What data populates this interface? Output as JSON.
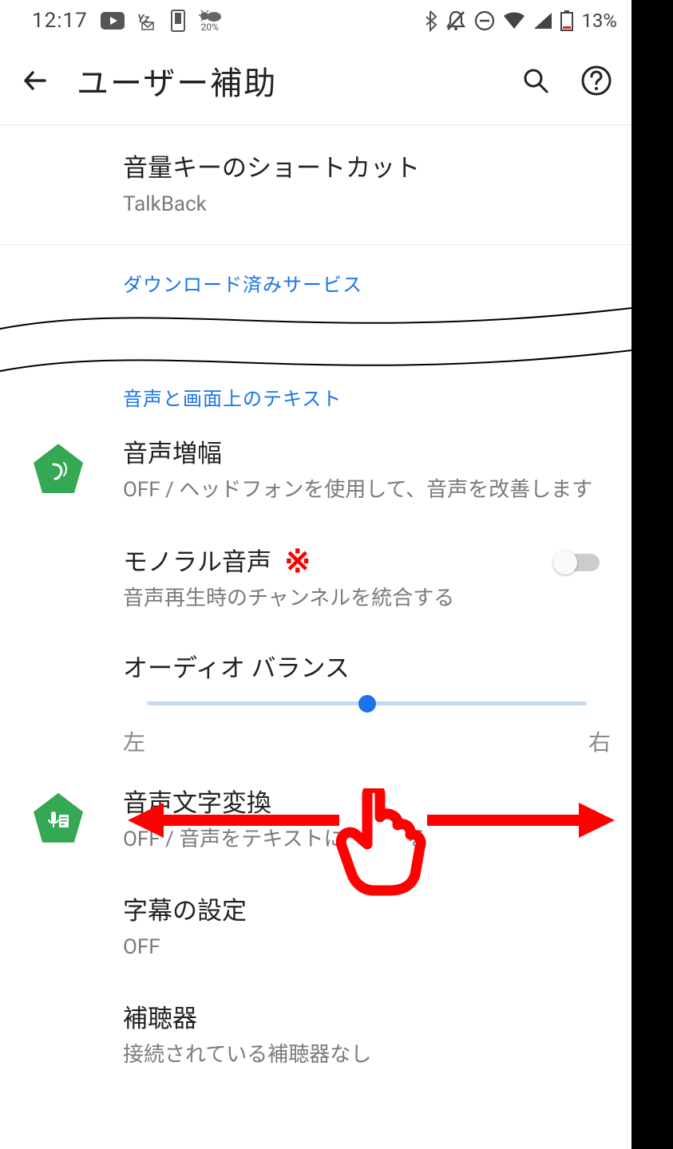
{
  "status": {
    "time": "12:17",
    "weather_pct": "20%",
    "battery_pct": "13%"
  },
  "appbar": {
    "title": "ユーザー補助"
  },
  "items": {
    "shortcut": {
      "title": "音量キーのショートカット",
      "sub": "TalkBack"
    },
    "section_downloaded": "ダウンロード済みサービス",
    "section_audio": "音声と画面上のテキスト",
    "amplify": {
      "title": "音声増幅",
      "sub": "OFF / ヘッドフォンを使用して、音声を改善します"
    },
    "mono": {
      "title": "モノラル音声",
      "sub": "音声再生時のチャンネルを統合する"
    },
    "balance": {
      "title": "オーディオ バランス",
      "left": "左",
      "right": "右"
    },
    "transcribe": {
      "title": "音声文字変換",
      "sub_prefix": "OFF / 音声をテキストに",
      "sub_suffix": "る"
    },
    "captions": {
      "title": "字幕の設定",
      "sub": "OFF"
    },
    "hearing": {
      "title": "補聴器",
      "sub": "接続されている補聴器なし"
    }
  },
  "annotations": {
    "mono_mark": "※"
  }
}
